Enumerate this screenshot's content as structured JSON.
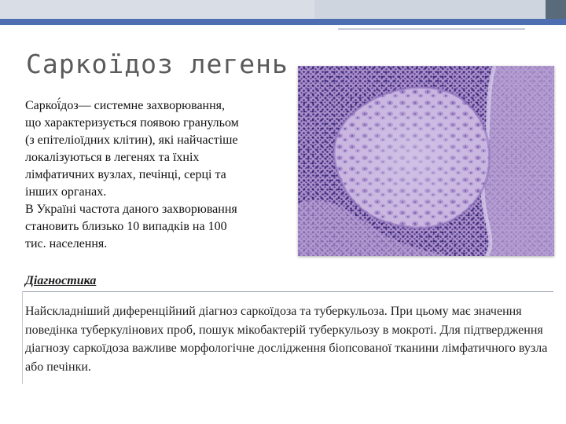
{
  "title": "Саркоїдоз легень",
  "intro": {
    "line1": "Саркої́доз— системне захворювання,",
    "line2": "що характеризується появою гранульом",
    "line3": "(з епітеліоїдних клітин), які найчастіше",
    "line4": "локалізуються в легенях та їхніх",
    "line5": "лімфатичних вузлах, печінці, серці та",
    "line6": "інших органах.",
    "line7": "В Україні частота даного захворювання",
    "line8": "становить близько 10 випадків на 100",
    "line9": "тис. населення."
  },
  "diagnostics": {
    "heading": "Діагностика",
    "text": "Найскладніший диференційний діагноз саркоїдоза та туберкульоза. При цьому має значення поведінка туберкулінових проб, пошук мікобактерій туберкульозу в мокроті. Для підтвердження діагнозу саркоїдоза важливе морфологічне дослідження біопсованої тканини лімфатичного вузла або печінки."
  },
  "colors": {
    "accent_blue": "#4d6eb0",
    "band_grey": "#d9dde6",
    "band_dark": "#596a7a",
    "stain_purple": "#8e6fb3"
  },
  "image": {
    "subject": "histology micrograph — granuloma (H&E stain)"
  }
}
